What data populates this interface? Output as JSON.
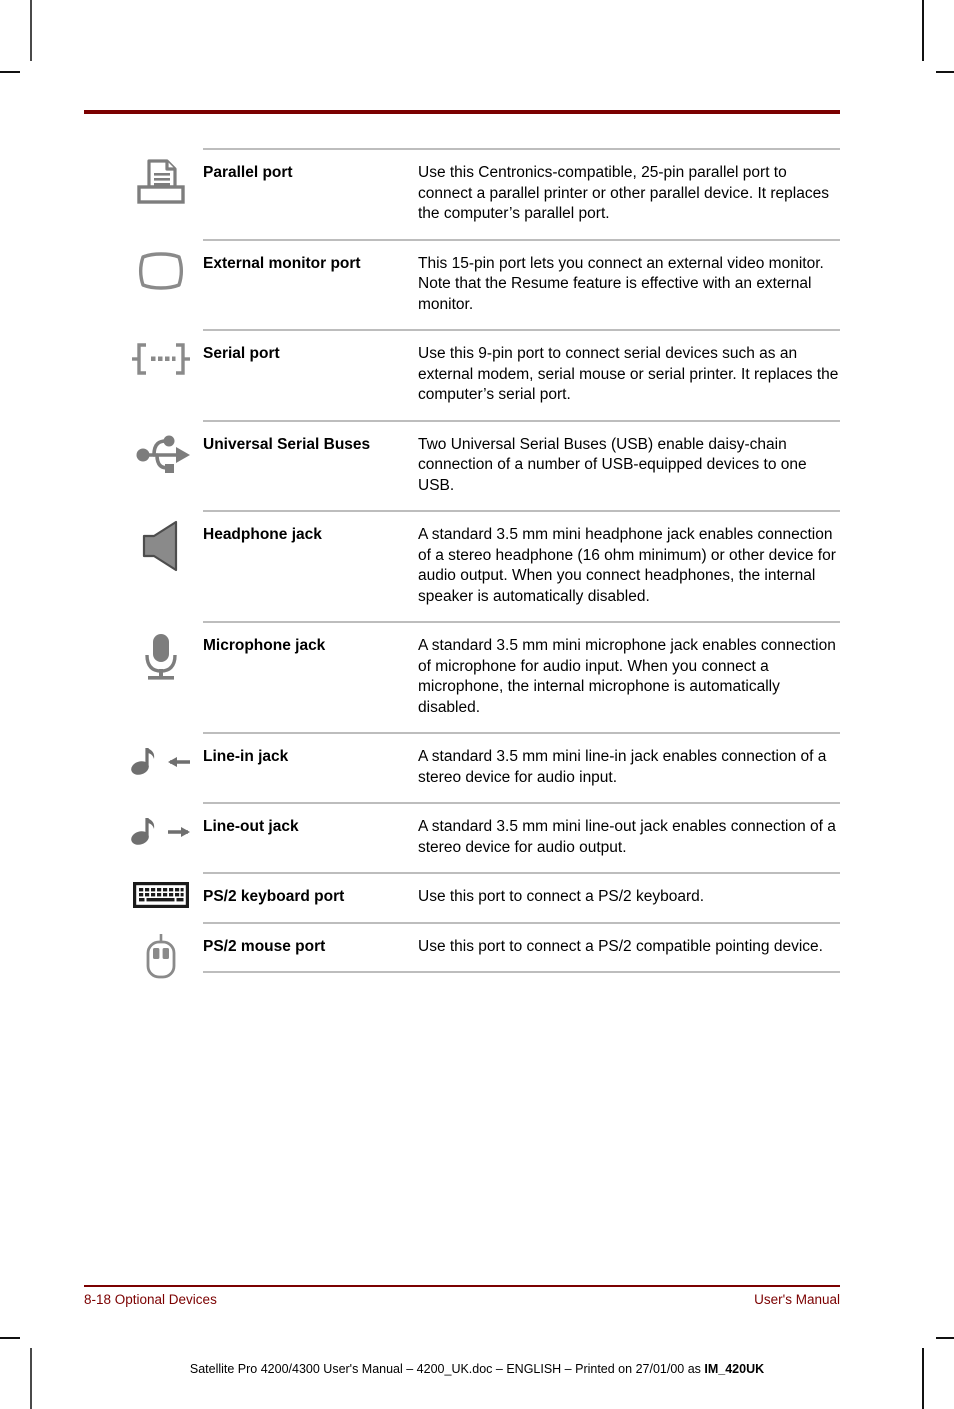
{
  "page": {
    "header_rule_color": "#7b0000",
    "footer_rule_color": "#7b0000",
    "rule_gray": "#bdbdbd"
  },
  "table": {
    "rows": [
      {
        "icon": "printer-icon",
        "label": "Parallel port",
        "description": "Use this Centronics-compatible, 25-pin parallel port to connect a parallel printer or other parallel device. It replaces the computer’s parallel port."
      },
      {
        "icon": "monitor-icon",
        "label": "External monitor port",
        "description": "This 15-pin port lets you connect an external video monitor. Note that the Resume feature is effective with an external monitor."
      },
      {
        "icon": "serial-port-icon",
        "label": "Serial port",
        "description": "Use this 9-pin port to connect serial devices such as an external modem, serial mouse or serial printer. It replaces the computer’s serial port."
      },
      {
        "icon": "usb-icon",
        "label": "Universal Serial Buses",
        "description": "Two Universal Serial Buses (USB) enable daisy-chain connection of a number of USB-equipped devices to one USB."
      },
      {
        "icon": "speaker-icon",
        "label": "Headphone jack",
        "description": "A standard 3.5 mm mini headphone jack enables connection of a stereo headphone (16 ohm minimum) or other device for audio output. When you connect headphones, the internal speaker is automatically disabled."
      },
      {
        "icon": "microphone-icon",
        "label": "Microphone jack",
        "description": "A standard 3.5 mm mini microphone jack enables connection of microphone for audio input. When you connect a microphone, the internal microphone is automatically disabled."
      },
      {
        "icon": "music-note-left-arrow-icon",
        "label": "Line-in jack",
        "description": "A standard 3.5 mm mini line-in jack enables connection of a stereo device for audio input."
      },
      {
        "icon": "music-note-right-arrow-icon",
        "label": "Line-out jack",
        "description": "A standard 3.5 mm mini line-out jack enables connection of a stereo device for audio output."
      },
      {
        "icon": "keyboard-icon",
        "label": "PS/2 keyboard port",
        "description": "Use this port to connect a PS/2 keyboard."
      },
      {
        "icon": "mouse-icon",
        "label": "PS/2 mouse port",
        "description": "Use this port to connect a PS/2 compatible pointing device."
      }
    ]
  },
  "footer": {
    "left": "8-18  Optional Devices",
    "right": "User's Manual",
    "print_line_main": "Satellite Pro 4200/4300 User's Manual  – 4200_UK.doc – ENGLISH – Printed on 27/01/00 as ",
    "print_line_bold": "IM_420UK"
  }
}
